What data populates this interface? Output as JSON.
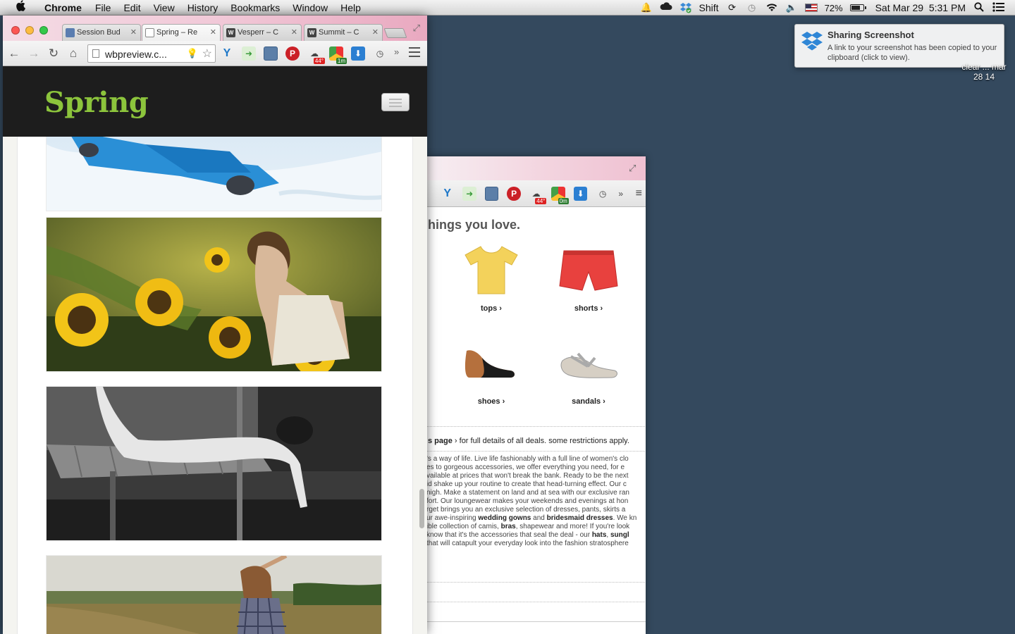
{
  "menubar": {
    "app_name": "Chrome",
    "menus": [
      "File",
      "Edit",
      "View",
      "History",
      "Bookmarks",
      "Window",
      "Help"
    ],
    "status": {
      "user": "Shift",
      "battery_percent": "72%",
      "battery_level": 0.72,
      "datetime": "Sat Mar 29  5:31 PM"
    }
  },
  "notification": {
    "title": "Sharing Screenshot",
    "body": "A link to your screenshot has been copied to your clipboard (click to view)."
  },
  "desktop_label": {
    "line1": "clear ... mar",
    "line2": "28 14"
  },
  "front_browser": {
    "tabs": [
      {
        "title": "Session Bud",
        "icon": "session-icon"
      },
      {
        "title": "Spring – Re",
        "icon": "page-icon"
      },
      {
        "title": "Vesperr – C",
        "icon": "w-logo-icon"
      },
      {
        "title": "Summit – C",
        "icon": "w-logo-icon"
      }
    ],
    "active_tab": 1,
    "url": "wbpreview.c...",
    "extension_badges": {
      "weather": "44°",
      "timer": "1m"
    },
    "site": {
      "logo": "Spring",
      "photos": [
        {
          "name": "snow-photo",
          "subject": "person lying in snow"
        },
        {
          "name": "sunflower-photo",
          "subject": "woman smelling sunflowers"
        },
        {
          "name": "dock-photo",
          "subject": "black and white woman on wooden dock"
        },
        {
          "name": "field-photo",
          "subject": "woman in plaid shirt in field"
        }
      ]
    }
  },
  "back_browser": {
    "extension_badges": {
      "weather": "44°",
      "timer": "0m"
    },
    "store": {
      "heading": "hings you love.",
      "products": [
        {
          "label": "tops ›",
          "icon": "tshirt-icon",
          "color": "#f3d25b"
        },
        {
          "label": "shorts ›",
          "icon": "shorts-icon",
          "color": "#e8413e"
        },
        {
          "label": "shoes ›",
          "icon": "shoe-icon",
          "color": "#b5703d"
        },
        {
          "label": "sandals ›",
          "icon": "sandal-icon",
          "color": "#b9b9b9"
        }
      ],
      "deal_link": "s page",
      "deal_text": " › for full details of all deals. some restrictions apply.",
      "blurb_lines": [
        [
          "'s a way of life. Live life fashionably with a full line of women's clo"
        ],
        [
          "es to gorgeous accessories, we offer everything you need, for e"
        ],
        [
          "vailable at prices that won't break the bank. Ready to be the next"
        ],
        [
          "id shake up your routine to create that head-turning effect. Our c"
        ],
        [
          "nigh. Make a statement on land and at sea with our exclusive ran"
        ],
        [
          "fort. Our loungewear makes your weekends and evenings at hon"
        ],
        [
          "rget brings you an exclusive selection of dresses, pants, skirts a"
        ],
        [
          "ur awe-inspiring ",
          {
            "b": "wedding gowns"
          },
          " and ",
          {
            "b": "bridesmaid dresses"
          },
          ". We kn"
        ],
        [
          "ible collection of camis, ",
          {
            "b": "bras"
          },
          ", shapewear and more! If you're look"
        ],
        [
          "know that it's the accessories that seal the deal - our ",
          {
            "b": "hats"
          },
          ", ",
          {
            "b": "sungl"
          }
        ],
        [
          "that will catapult your everyday look into the fashion stratosphere"
        ]
      ]
    }
  },
  "colors": {
    "desktop": "#34495e",
    "site_header": "#1d1d1d",
    "logo_green": "#8cc43c"
  }
}
